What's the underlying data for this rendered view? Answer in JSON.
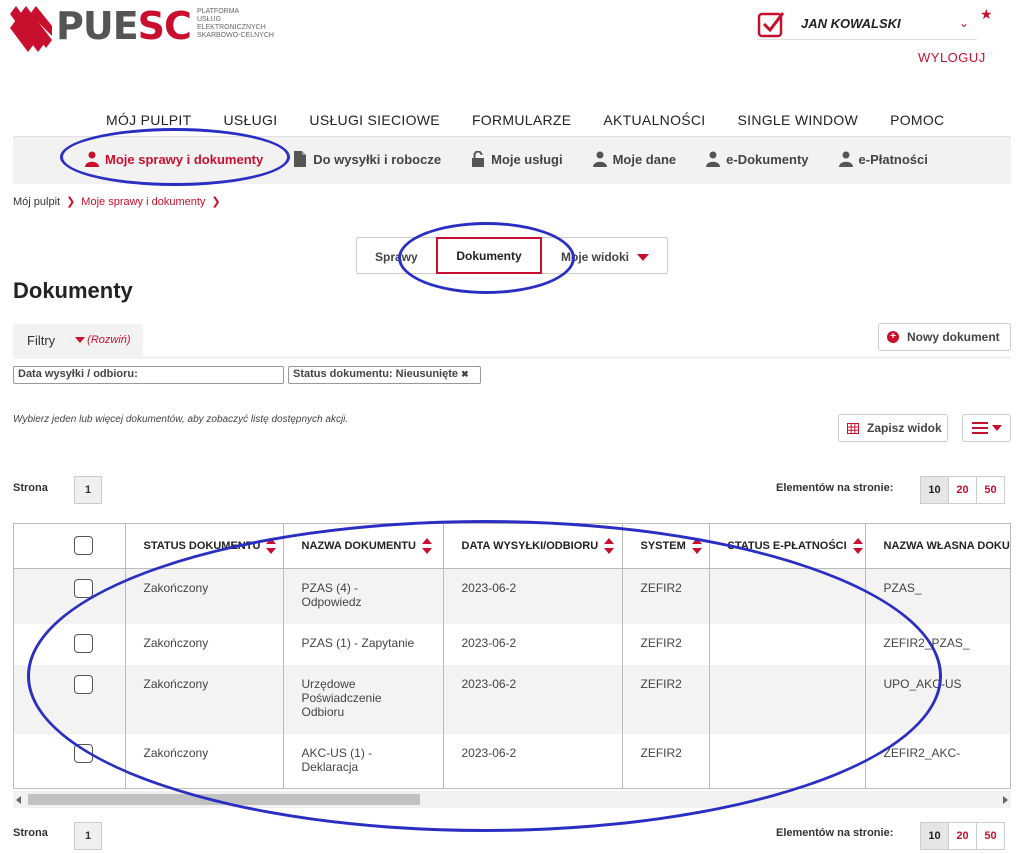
{
  "brand": {
    "logo_part1": "PUE",
    "logo_part2": "SC",
    "subtitle_lines": [
      "PLATFORMA",
      "USŁUG",
      "ELEKTRONICZNYCH",
      "SKARBOWO-CELNYCH"
    ],
    "accent_color": "#c8102e"
  },
  "user": {
    "name": "JAN KOWALSKI",
    "logout": "WYLOGUJ"
  },
  "main_nav": [
    "MÓJ PULPIT",
    "USŁUGI",
    "USŁUGI SIECIOWE",
    "FORMULARZE",
    "AKTUALNOŚCI",
    "SINGLE WINDOW",
    "POMOC"
  ],
  "sub_nav": [
    {
      "label": "Moje sprawy i dokumenty",
      "icon": "person-icon",
      "active": true
    },
    {
      "label": "Do wysyłki i robocze",
      "icon": "document-icon",
      "active": false
    },
    {
      "label": "Moje usługi",
      "icon": "lock-icon",
      "active": false
    },
    {
      "label": "Moje dane",
      "icon": "person-icon",
      "active": false
    },
    {
      "label": "e-Dokumenty",
      "icon": "person-icon",
      "active": false
    },
    {
      "label": "e-Płatności",
      "icon": "person-icon",
      "active": false
    }
  ],
  "breadcrumb": [
    "Mój pulpit",
    "Moje sprawy i dokumenty"
  ],
  "tabs": {
    "sprawy": "Sprawy",
    "dokumenty": "Dokumenty",
    "widoki": "Moje widoki"
  },
  "page_title": "Dokumenty",
  "filters": {
    "label": "Filtry",
    "toggle": "(Rozwiń)",
    "chip_date": "Data wysyłki / odbioru:",
    "chip_status": "Status dokumentu: Nieusunięte",
    "chip_remove": "✖"
  },
  "new_document": "Nowy dokument",
  "hint": "Wybierz jeden lub więcej dokumentów, aby zobaczyć listę dostępnych akcji.",
  "save_view": "Zapisz widok",
  "pagination": {
    "page_label": "Strona",
    "page": "1",
    "per_page_label": "Elementów na stronie:",
    "per_page_options": [
      "10",
      "20",
      "50"
    ],
    "selected": "10"
  },
  "table": {
    "columns": [
      "STATUS DOKUMENTU",
      "NAZWA DOKUMENTU",
      "DATA WYSYŁKI/ODBIORU",
      "SYSTEM",
      "STATUS E-PŁATNOŚCI",
      "NAZWA WŁASNA DOKUM"
    ],
    "rows": [
      {
        "status": "Zakończony",
        "name": "PZAS (4) - Odpowiedz",
        "date": "2023-06-2",
        "system": "ZEFIR2",
        "payment": "",
        "own_name": "PZAS_"
      },
      {
        "status": "Zakończony",
        "name": "PZAS (1) - Zapytanie",
        "date": "2023-06-2",
        "system": "ZEFIR2",
        "payment": "",
        "own_name": "ZEFIR2_PZAS_"
      },
      {
        "status": "Zakończony",
        "name": "Urzędowe Poświadczenie Odbioru",
        "date": "2023-06-2",
        "system": "ZEFIR2",
        "payment": "",
        "own_name": "UPO_AKC-US"
      },
      {
        "status": "Zakończony",
        "name": "AKC-US (1) - Deklaracja",
        "date": "2023-06-2",
        "system": "ZEFIR2",
        "payment": "",
        "own_name": "ZEFIR2_AKC-"
      }
    ]
  },
  "annotation_color": "#2a2fc2"
}
